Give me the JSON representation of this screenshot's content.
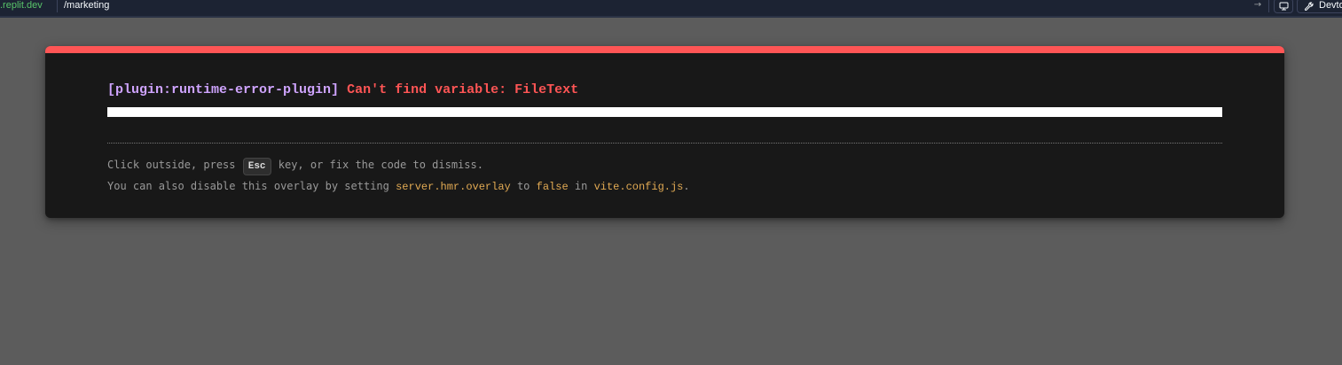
{
  "address_bar": {
    "domain": ".replit.dev",
    "path": "/marketing",
    "go_icon": "arrow-right-icon"
  },
  "toolbar": {
    "device_icon": "monitor-icon",
    "devtools_icon": "wrench-icon",
    "devtools_label": "Devtools"
  },
  "error_overlay": {
    "plugin": "[plugin:runtime-error-plugin]",
    "message": "Can't find variable: FileText",
    "tip_line1": {
      "before": "Click outside, press ",
      "key": "Esc",
      "after": " key, or fix the code to dismiss."
    },
    "tip_line2": {
      "before": "You can also disable this overlay by setting ",
      "setting": "server.hmr.overlay",
      "middle1": " to ",
      "value": "false",
      "middle2": " in ",
      "file": "vite.config.js",
      "end": "."
    }
  },
  "colors": {
    "accent_error": "#ff5555",
    "plugin": "#cfa4ff",
    "code": "#e2aa53",
    "backdrop": "#5c5c5c"
  }
}
